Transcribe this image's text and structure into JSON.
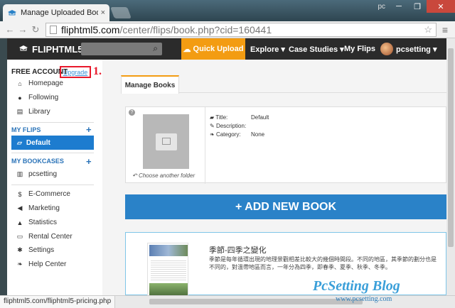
{
  "browser": {
    "tab_title": "Manage Uploaded Books",
    "tab_close": "×",
    "user_label": "pc",
    "window_controls": [
      "─",
      "❐",
      "✕"
    ],
    "url_host": "fliphtml5.com",
    "url_path": "/center/flips/book.php?cid=160441",
    "status_url": "fliphtml5.com/fliphtml5-pricing.php"
  },
  "site_nav": {
    "logo": "FLIPHTML5",
    "quick_upload": "Quick Upload",
    "explore": "Explore ▾",
    "case_studies": "Case Studies ▾",
    "my_flips": "My Flips",
    "username": "pcsetting ▾"
  },
  "sidebar": {
    "account_label": "FREE ACCOUNT",
    "upgrade_label": "Upgrade",
    "annotation": "1.",
    "top_items": [
      {
        "label": "Homepage",
        "icon": "home-icon"
      },
      {
        "label": "Following",
        "icon": "user-icon"
      },
      {
        "label": "Library",
        "icon": "library-icon"
      }
    ],
    "my_flips_heading": "MY FLIPS",
    "flips_items": [
      {
        "label": "Default",
        "icon": "folder-open-icon"
      }
    ],
    "my_bookcases_heading": "MY BOOKCASES",
    "bookcase_items": [
      {
        "label": "pcsetting",
        "icon": "bookcase-icon"
      }
    ],
    "bottom_items": [
      {
        "label": "E-Commerce",
        "icon": "dollar-icon"
      },
      {
        "label": "Marketing",
        "icon": "megaphone-icon"
      },
      {
        "label": "Statistics",
        "icon": "chart-icon"
      },
      {
        "label": "Rental Center",
        "icon": "card-icon"
      },
      {
        "label": "Settings",
        "icon": "gear-icon"
      },
      {
        "label": "Help Center",
        "icon": "leaf-icon"
      }
    ]
  },
  "main": {
    "tab_label": "Manage Books",
    "choose_folder": "Choose another folder",
    "meta": [
      {
        "key": "Title:",
        "value": "Default"
      },
      {
        "key": "Description:",
        "value": ""
      },
      {
        "key": "Category:",
        "value": "None"
      }
    ],
    "add_book_label": "+ ADD NEW BOOK",
    "flip": {
      "title": "季節-四季之變化",
      "description": "季節是每年循環出現的地理景觀相差比較大的幾個時間段。不同的地區，其季節的劃分也是不同的，對溫帶地區而言，一年分為四季，即春季、夏季、秋季、冬季。"
    }
  },
  "watermark": {
    "title": "PcSetting Blog",
    "url": "www.pcsetting.com"
  },
  "colors": {
    "accent_orange": "#f39c12",
    "accent_blue": "#2a82c8",
    "highlight_red": "#e8192c"
  }
}
